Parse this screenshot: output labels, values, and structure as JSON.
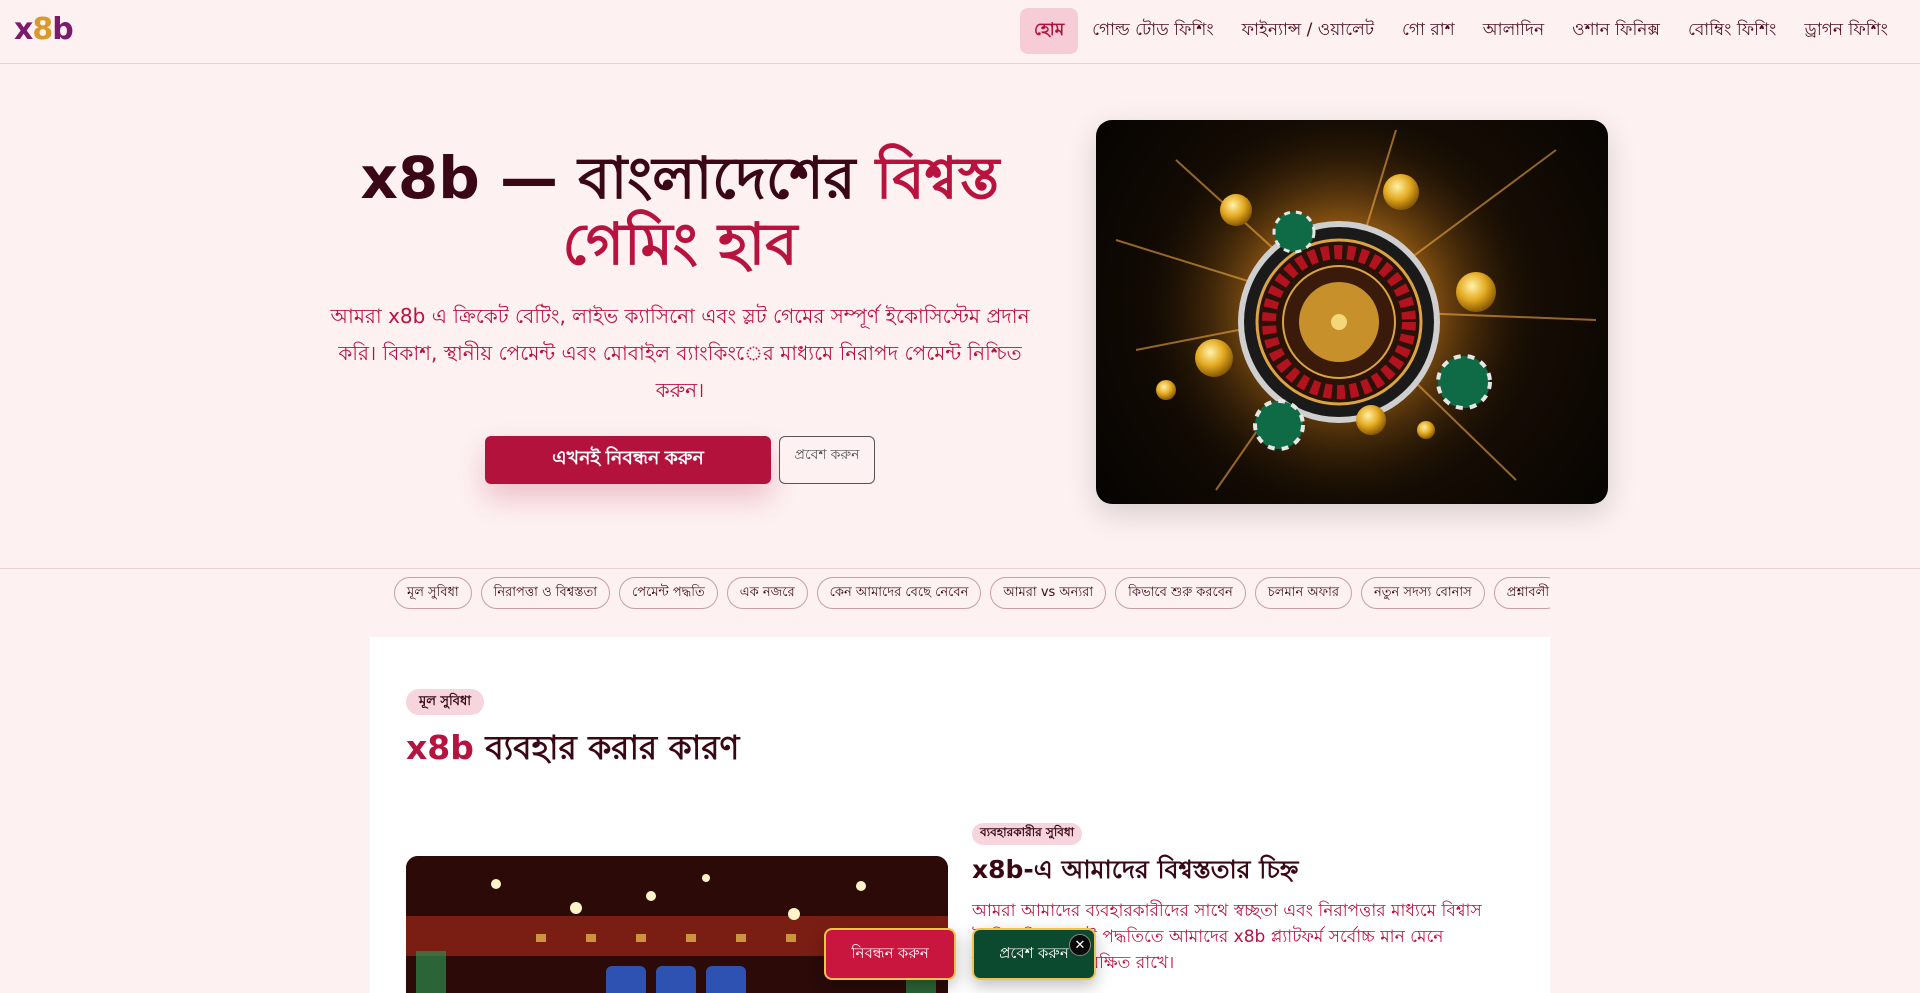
{
  "header": {
    "logo": {
      "part1": "x",
      "part2": "8",
      "part3": "b"
    },
    "nav": [
      {
        "label": "হোম",
        "active": true
      },
      {
        "label": "গোল্ড টোড ফিশিং"
      },
      {
        "label": "ফাইন্যান্স / ওয়ালেট"
      },
      {
        "label": "গো রাশ"
      },
      {
        "label": "আলাদিন"
      },
      {
        "label": "ওশান ফিনিক্স"
      },
      {
        "label": "বোম্বিং ফিশিং"
      },
      {
        "label": "ড্রাগন ফিশিং"
      }
    ]
  },
  "hero": {
    "title_part1": "x8b — বাংলাদেশের ",
    "title_accent": "বিশ্বস্ত গেমিং হাব",
    "subtitle": "আমরা x8b এ ক্রিকেট বেটিং, লাইভ ক্যাসিনো এবং স্লট গেমের সম্পূর্ণ ইকোসিস্টেম প্রদান করি। বিকাশ, স্থানীয় পেমেন্ট এবং মোবাইল ব্যাংকিংের মাধ্যমে নিরাপদ পেমেন্ট নিশ্চিত করুন।",
    "primary_button": "এখনই নিবন্ধন করুন",
    "secondary_button": "প্রবেশ করুন"
  },
  "section_nav": [
    "মূল সুবিধা",
    "নিরাপত্তা ও বিশ্বস্ততা",
    "পেমেন্ট পদ্ধতি",
    "এক নজরে",
    "কেন আমাদের বেছে নেবেন",
    "আমরা vs অন্যরা",
    "কিভাবে শুরু করবেন",
    "চলমান অফার",
    "নতুন সদস্য বোনাস",
    "প্রশ্নাবলী"
  ],
  "section": {
    "badge": "মূল সুবিধা",
    "title_accent": "x8b",
    "title_rest": " ব্যবহার করার কারণ",
    "feature": {
      "badge": "ব্যবহারকারীর সুবিধা",
      "title": "x8b-এ আমাদের বিশ্বস্ততার চিহ্ন",
      "text": "আমরা আমাদের ব্যবহারকারীদের সাথে স্বচ্ছতা এবং নিরাপত্তার মাধ্যমে বিশ্বাস তৈরি করি। পেমেন্ট পদ্ধতিতে আমাদের x8b প্ল্যাটফর্ম সর্বোচ্চ মান মেনে আপনার সম্পদ সুরক্ষিত রাখে।"
    }
  },
  "floating_cta": {
    "register": "নিবন্ধন করুন",
    "login": "প্রবেশ করুন",
    "close": "✕"
  }
}
